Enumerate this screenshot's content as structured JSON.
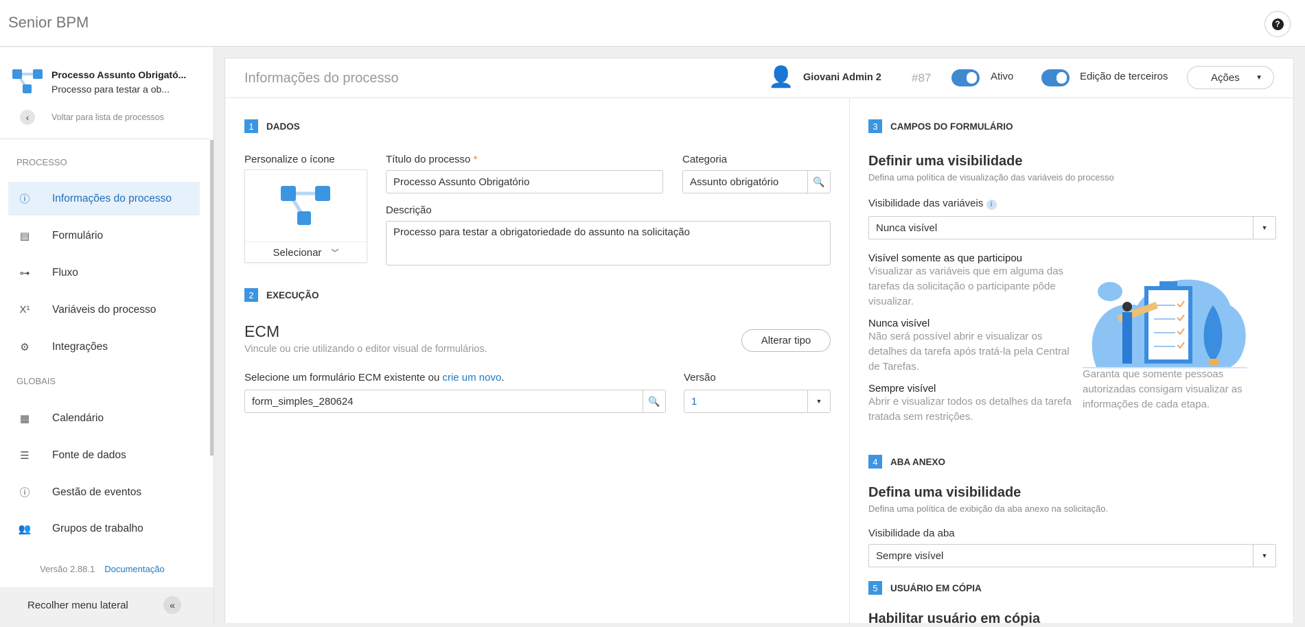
{
  "app": {
    "title": "Senior BPM",
    "help_icon": "question-icon"
  },
  "sidebar": {
    "process_title": "Processo Assunto Obrigató...",
    "process_subtitle": "Processo para testar a ob...",
    "back_label": "Voltar para lista de processos",
    "section_processo": "PROCESSO",
    "items": [
      {
        "label": "Informações do processo",
        "icon": "info-icon"
      },
      {
        "label": "Formulário",
        "icon": "form-icon"
      },
      {
        "label": "Fluxo",
        "icon": "flow-icon"
      },
      {
        "label": "Variáveis do processo",
        "icon": "variable-icon"
      },
      {
        "label": "Integrações",
        "icon": "gears-icon"
      }
    ],
    "section_globais": "GLOBAIS",
    "global_items": [
      {
        "label": "Calendário",
        "icon": "calendar-icon"
      },
      {
        "label": "Fonte de dados",
        "icon": "database-icon"
      },
      {
        "label": "Gestão de eventos",
        "icon": "alert-icon"
      },
      {
        "label": "Grupos de trabalho",
        "icon": "group-icon"
      }
    ],
    "version": "Versão 2.88.1",
    "docs_link": "Documentação",
    "collapse_label": "Recolher menu lateral"
  },
  "header": {
    "title": "Informações do processo",
    "user": "Giovani Admin 2",
    "id": "#87",
    "toggle_ativo": "Ativo",
    "toggle_edicao": "Edição de terceiros",
    "actions": "Ações"
  },
  "dados": {
    "num": "1",
    "title": "DADOS",
    "icon_label": "Personalize o ícone",
    "icon_select": "Selecionar",
    "titulo_label": "Título do processo",
    "required": "*",
    "titulo_value": "Processo Assunto Obrigatório",
    "categoria_label": "Categoria",
    "categoria_value": "Assunto obrigatório",
    "descricao_label": "Descrição",
    "descricao_value": "Processo para testar a obrigatoriedade do assunto na solicitação"
  },
  "execucao": {
    "num": "2",
    "title": "EXECUÇÃO",
    "type": "ECM",
    "subtitle": "Vincule ou crie utilizando o editor visual de formulários.",
    "change_type": "Alterar tipo",
    "form_label": "Selecione um formulário ECM existente ou",
    "form_link": "crie um novo",
    "form_label_end": ".",
    "form_value": "form_simples_280624",
    "versao_label": "Versão",
    "versao_value": "1"
  },
  "campos": {
    "num": "3",
    "title": "CAMPOS DO FORMULÁRIO",
    "heading": "Definir uma visibilidade",
    "subtitle": "Defina uma política de visualização das variáveis do processo",
    "vis_label": "Visibilidade das variáveis",
    "vis_value": "Nunca visível",
    "options": [
      {
        "title": "Visível somente as que participou",
        "text": "Visualizar as variáveis que em alguma das tarefas da solicitação o participante pôde visualizar."
      },
      {
        "title": "Nunca visível",
        "text": "Não será possível abrir e visualizar os detalhes da tarefa após tratá-la pela Central de Tarefas."
      },
      {
        "title": "Sempre visível",
        "text": "Abrir e visualizar todos os detalhes da tarefa tratada sem restrições."
      }
    ],
    "caption": "Garanta que somente pessoas autorizadas consigam visualizar as informações de cada etapa."
  },
  "anexo": {
    "num": "4",
    "title": "ABA ANEXO",
    "heading": "Defina uma visibilidade",
    "subtitle": "Defina uma política de exibição da aba anexo na solicitação.",
    "label": "Visibilidade da aba",
    "value": "Sempre visível"
  },
  "copia": {
    "num": "5",
    "title": "USUÁRIO EM CÓPIA",
    "heading": "Habilitar usuário em cópia"
  },
  "colors": {
    "accent": "#3b95e0",
    "toggle": "#3f89d1",
    "active_bg": "#e7f1fb"
  }
}
